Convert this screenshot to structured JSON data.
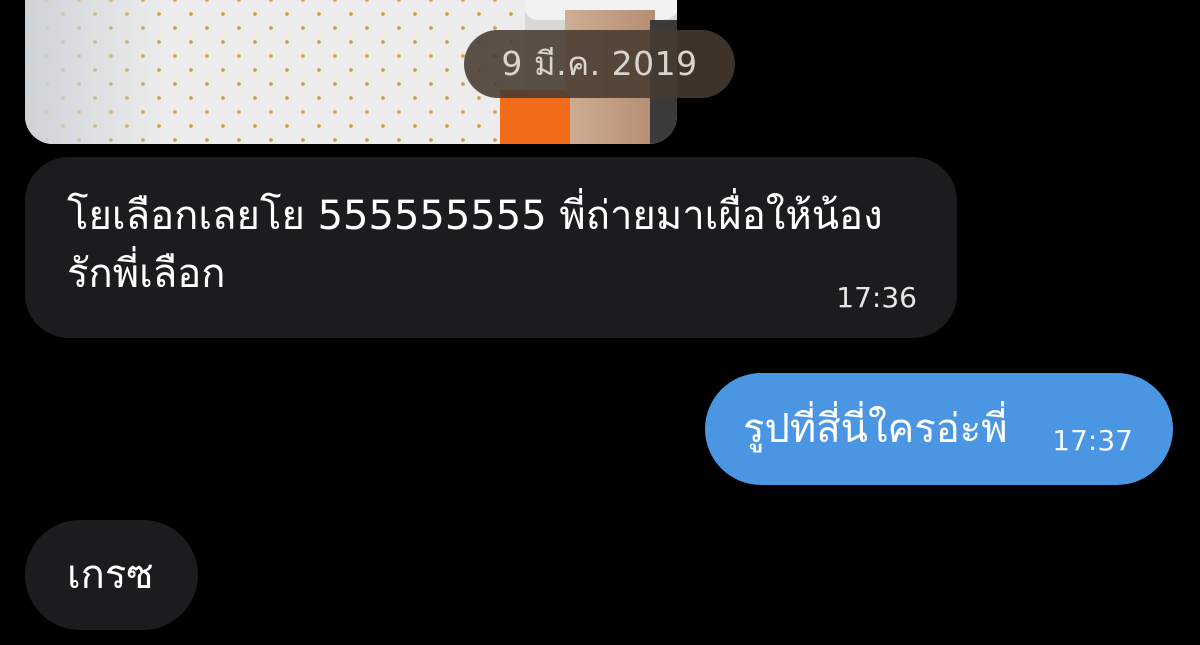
{
  "photo": {
    "alt": "photo-message"
  },
  "date_pill": "9 มี.ค. 2019",
  "messages": [
    {
      "direction": "incoming",
      "text": "โยเลือกเลยโย 555555555 พี่ถ่ายมาเผื่อให้น้องรักพี่เลือก",
      "time": "17:36"
    },
    {
      "direction": "outgoing",
      "text": "รูปที่สี่นี่ใครอ่ะพี่",
      "time": "17:37"
    },
    {
      "direction": "incoming",
      "text": "เกรซ"
    }
  ],
  "colors": {
    "background": "#000000",
    "incoming_bubble": "#1c1c1e",
    "outgoing_bubble": "#4a96e3",
    "date_pill": "#463a30"
  }
}
